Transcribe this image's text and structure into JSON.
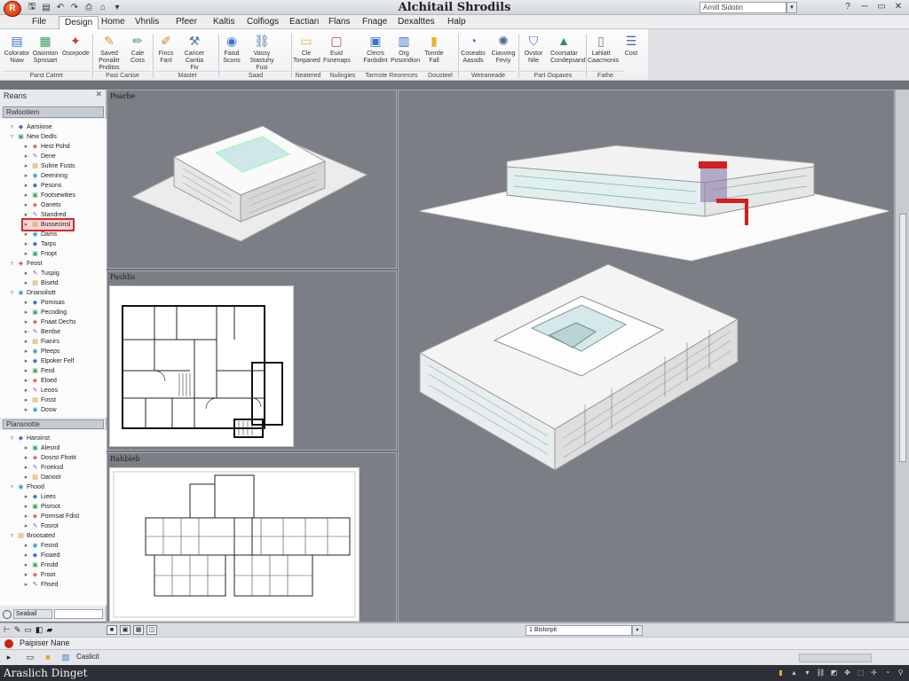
{
  "app": {
    "title": "Alchitail Shrodils",
    "search_value": "Arnitl Sidotin",
    "logo_letter": "R"
  },
  "menu_tabs": [
    "File",
    "Design",
    "Home",
    "Vhnlis",
    "Pfeer",
    "Kaltis",
    "Colfiogs",
    "Eactian",
    "Flans",
    "Fnage",
    "Dexalttes",
    "Halp"
  ],
  "ribbon": {
    "buttons": [
      {
        "label": "Colorator Niaw",
        "icon": "doc-color-icon",
        "glyph": "▤",
        "color": "#3a73c7"
      },
      {
        "label": "Oaionton Sprosart",
        "icon": "sheet-icon",
        "glyph": "▦",
        "color": "#3aa05a"
      },
      {
        "label": "Osorpode",
        "icon": "shapes-icon",
        "glyph": "✦",
        "color": "#c73a3a"
      },
      {
        "label": "Saved Ponalitr Pnditos",
        "icon": "brush-icon",
        "glyph": "✎",
        "color": "#c7a23a"
      },
      {
        "label": "Cale Coss",
        "icon": "pen-icon",
        "glyph": "✏",
        "color": "#3aa05a"
      },
      {
        "label": "Fincs Fanl",
        "icon": "pencil-icon",
        "glyph": "✐",
        "color": "#d08a1a"
      },
      {
        "label": "Caricer Cantia Fiv",
        "icon": "tool-icon",
        "glyph": "⚒",
        "color": "#5576a6"
      },
      {
        "label": "Faisd Scons",
        "icon": "globe-icon",
        "glyph": "◉",
        "color": "#3a73c7"
      },
      {
        "label": "Vassy Stastuhy Fusi",
        "icon": "link-icon",
        "glyph": "⛓",
        "color": "#5576a6"
      },
      {
        "label": "Cle Tonpaned",
        "icon": "folder-icon",
        "glyph": "▭",
        "color": "#e6b22c"
      },
      {
        "label": "Euid Fsnenaps",
        "icon": "board-icon",
        "glyph": "▢",
        "color": "#c73a3a"
      },
      {
        "label": "Clecrs Fanbdint",
        "icon": "camera-icon",
        "glyph": "▣",
        "color": "#3a73c7"
      },
      {
        "label": "Org Posondion",
        "icon": "layers-icon",
        "glyph": "▥",
        "color": "#3a73c7"
      },
      {
        "label": "Tonrde Fall",
        "icon": "stack-icon",
        "glyph": "▮",
        "color": "#e6b22c"
      },
      {
        "label": "Coseabs Aasods",
        "icon": "bubble-icon",
        "glyph": "◔",
        "color": "#3a73c7"
      },
      {
        "label": "Ciavving Feviy",
        "icon": "wheel-icon",
        "glyph": "✺",
        "color": "#4a6a8a"
      },
      {
        "label": "Ovstor Nile",
        "icon": "shield-icon",
        "glyph": "⛉",
        "color": "#3a73c7"
      },
      {
        "label": "Coorsatar Condepsand",
        "icon": "triangle-icon",
        "glyph": "▲",
        "color": "#2d8a6a"
      },
      {
        "label": "Lahlatt Caacmonis",
        "icon": "page-icon",
        "glyph": "▯",
        "color": "#777777"
      },
      {
        "label": "Cost",
        "icon": "list-icon",
        "glyph": "☰",
        "color": "#4a6a9a"
      }
    ],
    "groups": [
      "Parst Catret",
      "Past Canise",
      "Mastet",
      "Saad",
      "Neatered",
      "Nulingies",
      "Tarmste Reorerces",
      "Dousteel",
      "Wetraneade",
      "Part Oopaxes",
      "Fathe"
    ]
  },
  "project_browser": {
    "header": "Reans",
    "section1": "Rwlootiem",
    "section2": "Plansnotte",
    "items": [
      {
        "label": "Aarsiiose",
        "level": 0
      },
      {
        "label": "New Dedls",
        "level": 0
      },
      {
        "label": "Hest Pohd",
        "level": 1
      },
      {
        "label": "Dene",
        "level": 1
      },
      {
        "label": "Suline Fusts",
        "level": 1
      },
      {
        "label": "Deeninng",
        "level": 1
      },
      {
        "label": "Pesons",
        "level": 1
      },
      {
        "label": "Footsewities",
        "level": 1
      },
      {
        "label": "Oanets",
        "level": 1
      },
      {
        "label": "Standred",
        "level": 1
      },
      {
        "label": "Bussecinsl",
        "level": 1,
        "selected": true
      },
      {
        "label": "Dams",
        "level": 1
      },
      {
        "label": "Tarps",
        "level": 1
      },
      {
        "label": "Fnopt",
        "level": 1
      },
      {
        "label": "Feost",
        "level": 0
      },
      {
        "label": "Tuspig",
        "level": 1
      },
      {
        "label": "Bisetd",
        "level": 1
      },
      {
        "label": "Drianoilsitt",
        "level": 0
      },
      {
        "label": "Pomisas",
        "level": 1
      },
      {
        "label": "Pecoding",
        "level": 1
      },
      {
        "label": "Fnaat Dechs",
        "level": 1
      },
      {
        "label": "Berdse",
        "level": 1
      },
      {
        "label": "Fianirs",
        "level": 1
      },
      {
        "label": "Pleeps",
        "level": 1
      },
      {
        "label": "Elpoker Felf",
        "level": 1
      },
      {
        "label": "Fesd",
        "level": 1
      },
      {
        "label": "Eloed",
        "level": 1
      },
      {
        "label": "Leoos",
        "level": 1
      },
      {
        "label": "Fosst",
        "level": 1
      },
      {
        "label": "Dosw",
        "level": 1
      }
    ],
    "items2": [
      {
        "label": "Haroinst",
        "level": 0
      },
      {
        "label": "Alesnd",
        "level": 1
      },
      {
        "label": "Dosrst Fhotit",
        "level": 1
      },
      {
        "label": "Froeksd",
        "level": 1
      },
      {
        "label": "Danoot",
        "level": 1
      },
      {
        "label": "Fhood",
        "level": 0
      },
      {
        "label": "Liees",
        "level": 1
      },
      {
        "label": "Pisroot",
        "level": 1
      },
      {
        "label": "Pormsat Fdist",
        "level": 1
      },
      {
        "label": "Fosrot",
        "level": 1
      },
      {
        "label": "Broosated",
        "level": 0
      },
      {
        "label": "Fesnd",
        "level": 1
      },
      {
        "label": "Fioaed",
        "level": 1
      },
      {
        "label": "Fnsdd",
        "level": 1
      },
      {
        "label": "Froot",
        "level": 1
      },
      {
        "label": "Fhsed",
        "level": 1
      }
    ],
    "footer_text": "Seabail"
  },
  "viewports": {
    "v1_label": "Poarbe",
    "v2_label": "Pashlis",
    "v3_label": "Rahbleb"
  },
  "bottombar": {
    "scale_value": "1 Bistorpit"
  },
  "properties": {
    "title": "Paipiser Nane"
  },
  "toolrow": {
    "label": "Caslicit"
  },
  "status": {
    "text": "Araslich Dinget"
  }
}
